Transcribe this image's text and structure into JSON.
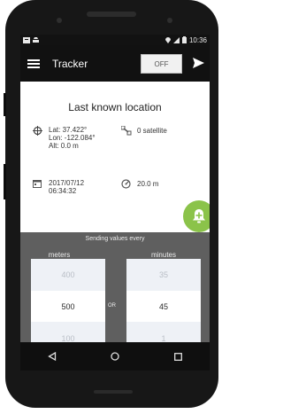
{
  "status_bar": {
    "time": "10:36"
  },
  "app_bar": {
    "title": "Tracker",
    "toggle_label": "OFF"
  },
  "location": {
    "title": "Last known location",
    "lat": "Lat: 37.422°",
    "lon": "Lon: -122.084°",
    "alt": "Alt: 0.0 m",
    "satellites": "0 satellite",
    "date": "2017/07/12",
    "time": "06:34:32",
    "accuracy": "20.0 m"
  },
  "sending": {
    "title": "Sending values every",
    "or_label": "OR",
    "meters": {
      "label": "meters",
      "above": "400",
      "selected": "500",
      "below": "100"
    },
    "minutes": {
      "label": "minutes",
      "above": "35",
      "selected": "45",
      "below": "1"
    }
  },
  "fab": {
    "icon": "bell-plus-icon",
    "color": "#8bc34a"
  },
  "navbar": {
    "icons": [
      "back-icon",
      "home-icon",
      "recents-icon"
    ]
  }
}
